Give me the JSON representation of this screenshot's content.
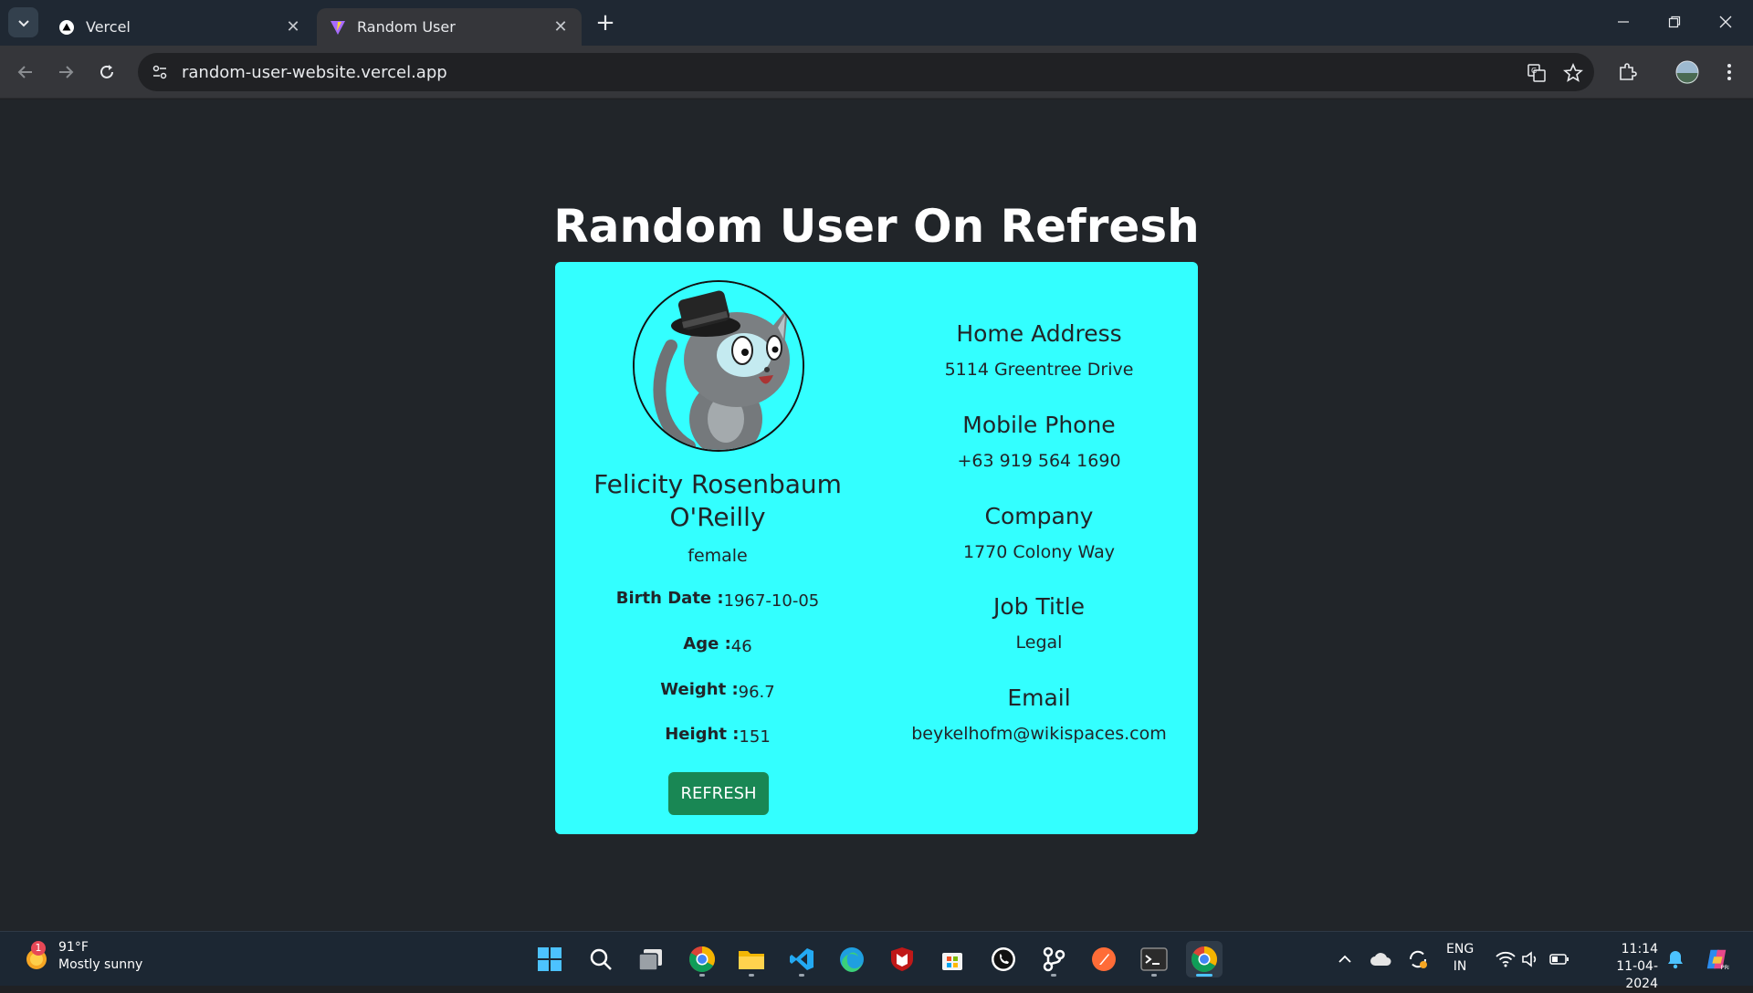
{
  "browser": {
    "tabs": [
      {
        "title": "Vercel",
        "icon": "vercel-triangle-icon"
      },
      {
        "title": "Random User",
        "icon": "vite-icon"
      }
    ],
    "url": "random-user-website.vercel.app"
  },
  "page": {
    "heading": "Random User On Refresh",
    "user": {
      "name": "Felicity Rosenbaum O'Reilly",
      "gender": "female",
      "stats": [
        {
          "label": "Birth Date :",
          "value": "1967-10-05"
        },
        {
          "label": "Age :",
          "value": "46"
        },
        {
          "label": "Weight :",
          "value": "96.7"
        },
        {
          "label": "Height :",
          "value": "151"
        }
      ],
      "refresh_label": "REFRESH",
      "info": [
        {
          "heading": "Home Address",
          "text": "5114 Greentree Drive"
        },
        {
          "heading": "Mobile Phone",
          "text": "+63 919 564 1690"
        },
        {
          "heading": "Company",
          "text": "1770 Colony Way"
        },
        {
          "heading": "Job Title",
          "text": "Legal"
        },
        {
          "heading": "Email",
          "text": "beykelhofm@wikispaces.com"
        }
      ]
    },
    "card_color": "#33ffff",
    "button_color": "#198754"
  },
  "taskbar": {
    "weather": {
      "badge": "1",
      "temp": "91°F",
      "desc": "Mostly sunny"
    },
    "language": {
      "line1": "ENG",
      "line2": "IN"
    },
    "clock": {
      "time": "11:14",
      "date": "11-04-2024"
    }
  }
}
